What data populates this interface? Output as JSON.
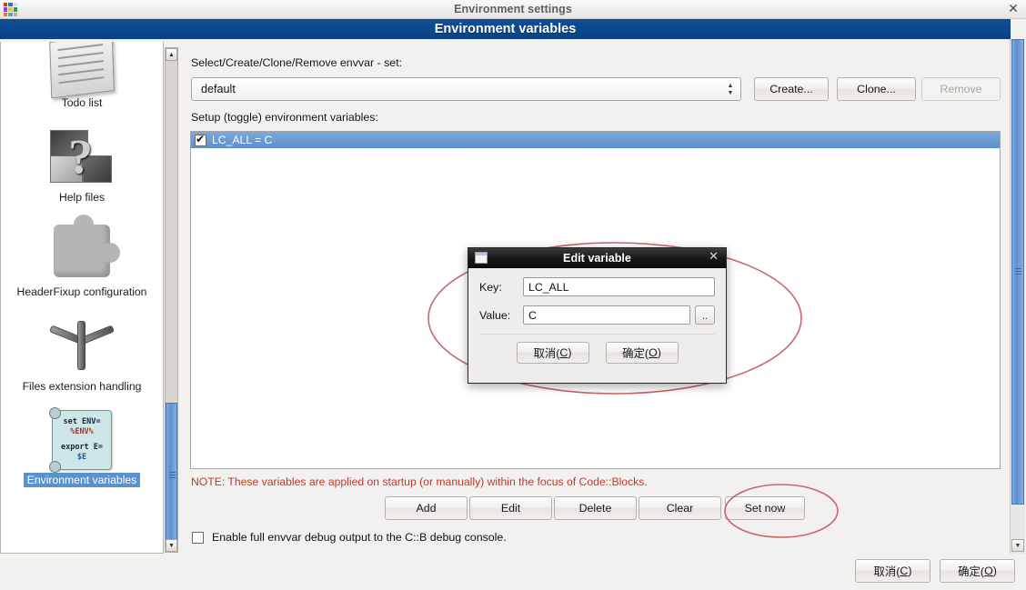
{
  "window": {
    "os_title": "Environment settings",
    "close_icon": "✕",
    "page_title": "Environment variables"
  },
  "sidebar": {
    "items": [
      {
        "label": "Todo list",
        "icon": "todo-list-icon",
        "selected": false
      },
      {
        "label": "Help files",
        "icon": "help-files-icon",
        "selected": false
      },
      {
        "label": "HeaderFixup configuration",
        "icon": "puzzle-piece-icon",
        "selected": false
      },
      {
        "label": "Files extension handling",
        "icon": "jackstraw-icon",
        "selected": false
      },
      {
        "label": "Environment variables",
        "icon": "envvar-script-icon",
        "selected": true
      }
    ],
    "envvar_icon_text": {
      "line1": "set ENV=",
      "line2": "%ENV%",
      "line3": "export E=",
      "line4": "$E"
    },
    "scroll_up_icon": "▲",
    "scroll_down_icon": "▼"
  },
  "main": {
    "set_label": "Select/Create/Clone/Remove envvar - set:",
    "set_value": "default",
    "set_options": [
      "default"
    ],
    "create_label": "Create...",
    "clone_label": "Clone...",
    "remove_label": "Remove",
    "list_label": "Setup (toggle) environment variables:",
    "variables": [
      {
        "checked": true,
        "text": "LC_ALL = C"
      }
    ],
    "note": "NOTE: These variables are applied on startup (or manually) within the focus of Code::Blocks.",
    "buttons": [
      {
        "label": "Add",
        "name": "add-button"
      },
      {
        "label": "Edit",
        "name": "edit-button"
      },
      {
        "label": "Delete",
        "name": "delete-button"
      },
      {
        "label": "Clear",
        "name": "clear-button"
      },
      {
        "label": "Set now",
        "name": "set-now-button"
      }
    ],
    "debug_checkbox": {
      "checked": false,
      "label": "Enable full envvar debug output to the C::B debug console."
    }
  },
  "dialog": {
    "title": "Edit variable",
    "close_icon": "✕",
    "key_label": "Key:",
    "key_value": "LC_ALL",
    "value_label": "Value:",
    "value_value": "C",
    "browse_label": "..",
    "cancel_label": "取消(C)",
    "cancel_prefix": "取消(",
    "cancel_accel": "C",
    "cancel_suffix": ")",
    "ok_label": "确定(O)",
    "ok_prefix": "确定(",
    "ok_accel": "O",
    "ok_suffix": ")"
  },
  "footer": {
    "cancel_prefix": "取消(",
    "cancel_accel": "C",
    "cancel_suffix": ")",
    "ok_prefix": "确定(",
    "ok_accel": "O",
    "ok_suffix": ")"
  },
  "annotations": {
    "color": "#c8666b",
    "shapes": [
      "ellipse-around-edit-dialog",
      "ellipse-around-set-now-button"
    ]
  },
  "colors": {
    "header_blue": "#0b4a8f",
    "selection_blue": "#5f8fcc",
    "note_red": "#c0392b",
    "annotation_red": "#c8666b",
    "window_bg": "#f2f1f0"
  }
}
